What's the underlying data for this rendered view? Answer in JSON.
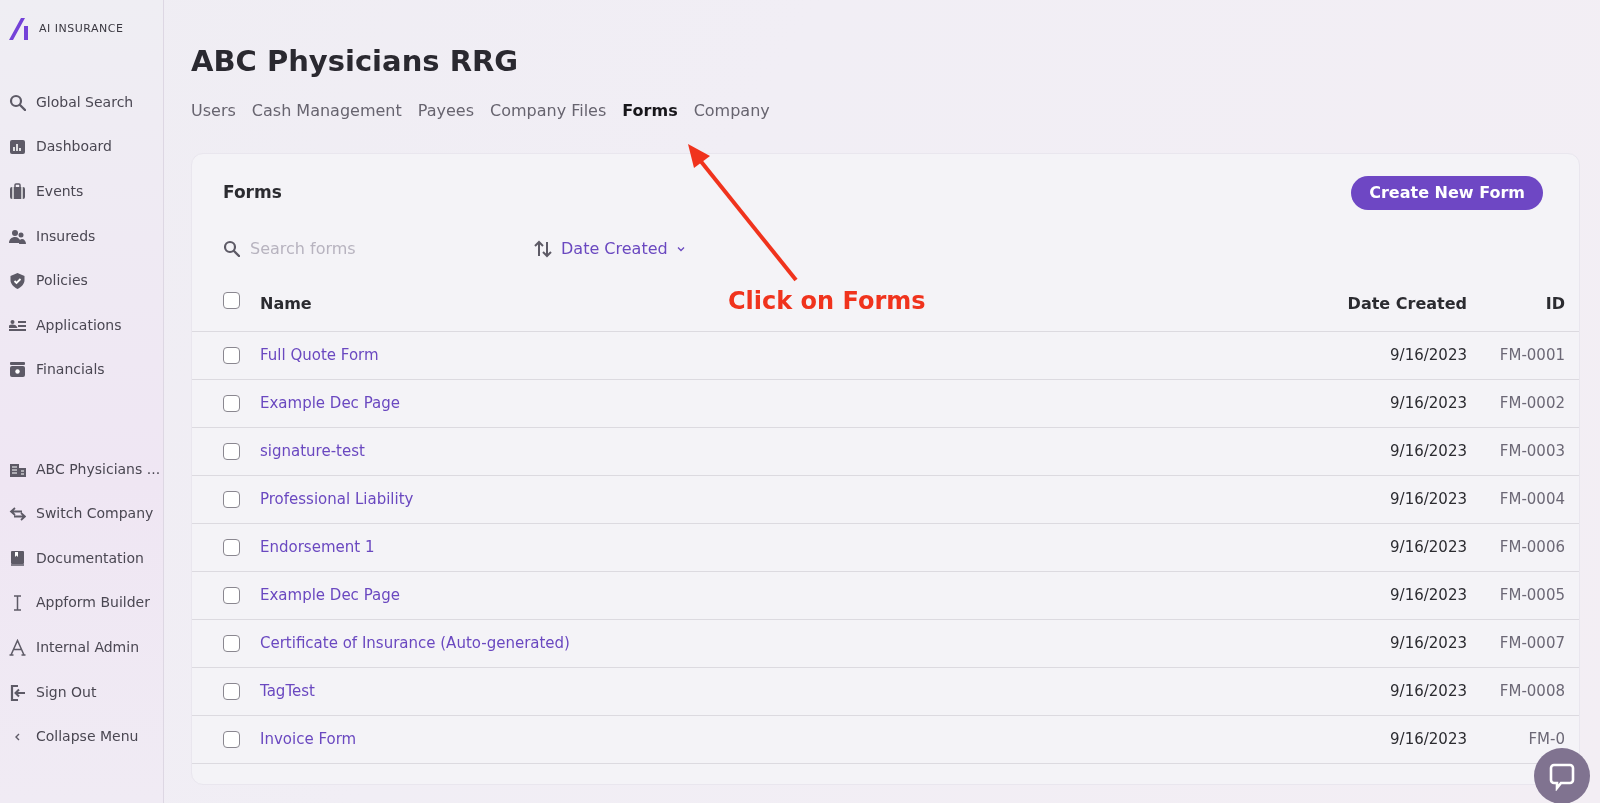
{
  "logo": {
    "text": "AI INSURANCE"
  },
  "sidebar": {
    "items": [
      {
        "label": "Global Search"
      },
      {
        "label": "Dashboard"
      },
      {
        "label": "Events"
      },
      {
        "label": "Insureds"
      },
      {
        "label": "Policies"
      },
      {
        "label": "Applications"
      },
      {
        "label": "Financials"
      }
    ],
    "bottom_items": [
      {
        "label": "ABC Physicians ..."
      },
      {
        "label": "Switch Company"
      },
      {
        "label": "Documentation"
      },
      {
        "label": "Appform Builder"
      },
      {
        "label": "Internal Admin"
      },
      {
        "label": "Sign Out"
      },
      {
        "label": "Collapse Menu"
      }
    ]
  },
  "page": {
    "title": "ABC Physicians RRG"
  },
  "tabs": [
    {
      "label": "Users",
      "selected": false
    },
    {
      "label": "Cash Management",
      "selected": false
    },
    {
      "label": "Payees",
      "selected": false
    },
    {
      "label": "Company Files",
      "selected": false
    },
    {
      "label": "Forms",
      "selected": true
    },
    {
      "label": "Company",
      "selected": false
    }
  ],
  "card": {
    "title": "Forms",
    "button": "Create New Form",
    "search": {
      "placeholder": "Search forms"
    },
    "sort": {
      "label": "Date Created"
    }
  },
  "table": {
    "select_all_checked": false,
    "columns": [
      "Name",
      "Date Created",
      "ID"
    ],
    "rows": [
      {
        "name": "Full Quote Form",
        "date": "9/16/2023",
        "id": "FM-0001",
        "checked": false
      },
      {
        "name": "Example Dec Page",
        "date": "9/16/2023",
        "id": "FM-0002",
        "checked": false
      },
      {
        "name": "signature-test",
        "date": "9/16/2023",
        "id": "FM-0003",
        "checked": false
      },
      {
        "name": "Professional Liability",
        "date": "9/16/2023",
        "id": "FM-0004",
        "checked": false
      },
      {
        "name": "Endorsement 1",
        "date": "9/16/2023",
        "id": "FM-0006",
        "checked": false
      },
      {
        "name": "Example Dec Page",
        "date": "9/16/2023",
        "id": "FM-0005",
        "checked": false
      },
      {
        "name": "Certificate of Insurance (Auto-generated)",
        "date": "9/16/2023",
        "id": "FM-0007",
        "checked": false
      },
      {
        "name": "TagTest",
        "date": "9/16/2023",
        "id": "FM-0008",
        "checked": false
      },
      {
        "name": "Invoice Form",
        "date": "9/16/2023",
        "id": "FM-0",
        "checked": false
      }
    ]
  },
  "annotation": {
    "text": "Click on Forms"
  }
}
